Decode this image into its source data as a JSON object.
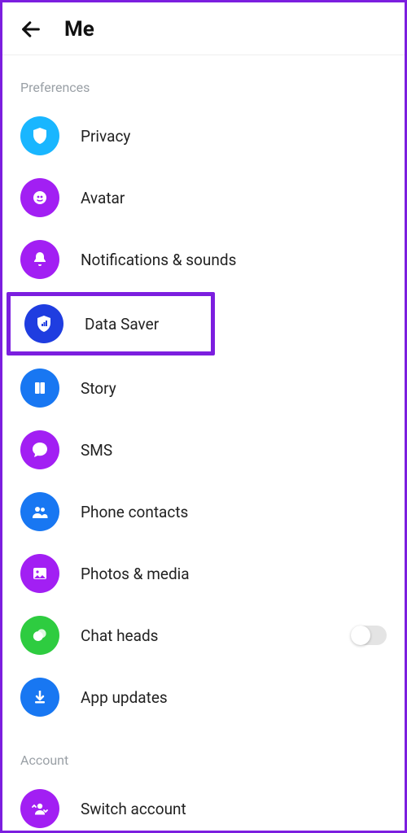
{
  "header": {
    "title": "Me"
  },
  "sections": {
    "preferences": {
      "label": "Preferences",
      "items": [
        {
          "id": "privacy",
          "label": "Privacy"
        },
        {
          "id": "avatar",
          "label": "Avatar"
        },
        {
          "id": "notifications",
          "label": "Notifications & sounds"
        },
        {
          "id": "data-saver",
          "label": "Data Saver",
          "highlighted": true
        },
        {
          "id": "story",
          "label": "Story"
        },
        {
          "id": "sms",
          "label": "SMS"
        },
        {
          "id": "phone-contacts",
          "label": "Phone contacts"
        },
        {
          "id": "photos-media",
          "label": "Photos & media"
        },
        {
          "id": "chat-heads",
          "label": "Chat heads",
          "toggle": false
        },
        {
          "id": "app-updates",
          "label": "App updates"
        }
      ]
    },
    "account": {
      "label": "Account",
      "items": [
        {
          "id": "switch-account",
          "label": "Switch account"
        }
      ]
    }
  }
}
